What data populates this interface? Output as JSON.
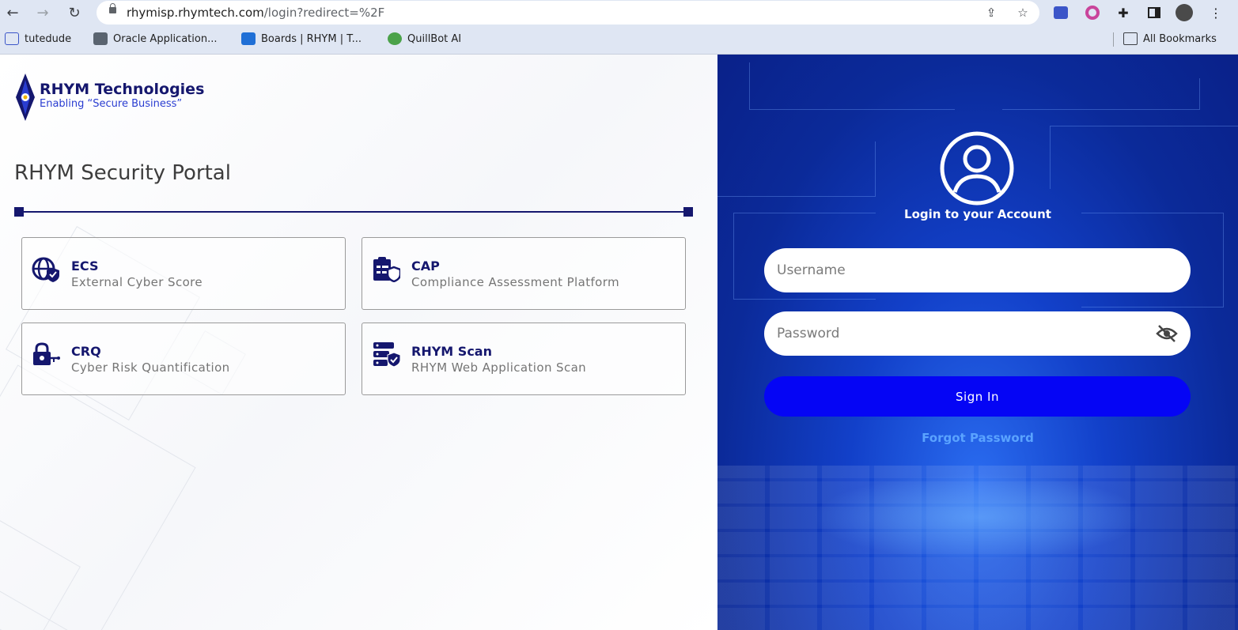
{
  "browser": {
    "url_host": "rhymisp.rhymtech.com",
    "url_path": "/login?redirect=%2F",
    "bookmarks": [
      {
        "label": "tutedude"
      },
      {
        "label": "Oracle Application..."
      },
      {
        "label": "Boards | RHYM | T..."
      },
      {
        "label": "QuillBot AI"
      }
    ],
    "all_bookmarks": "All Bookmarks"
  },
  "brand": {
    "name": "RHYM Technologies",
    "tagline": "Enabling “Secure Business”"
  },
  "portal": {
    "title": "RHYM Security Portal",
    "cards": [
      {
        "title": "ECS",
        "subtitle": "External Cyber Score",
        "icon": "globe-shield-icon"
      },
      {
        "title": "CAP",
        "subtitle": "Compliance Assessment Platform",
        "icon": "clipboard-shield-icon"
      },
      {
        "title": "CRQ",
        "subtitle": "Cyber Risk Quantification",
        "icon": "lock-key-icon"
      },
      {
        "title": "RHYM Scan",
        "subtitle": "RHYM Web Application Scan",
        "icon": "server-shield-icon"
      }
    ]
  },
  "login": {
    "title": "Login to your Account",
    "username_placeholder": "Username",
    "password_placeholder": "Password",
    "sign_in": "Sign In",
    "forgot": "Forgot Password"
  },
  "colors": {
    "brand_navy": "#15176e",
    "sign_in_blue": "#0505f5",
    "forgot_link": "#5aa3ff"
  }
}
